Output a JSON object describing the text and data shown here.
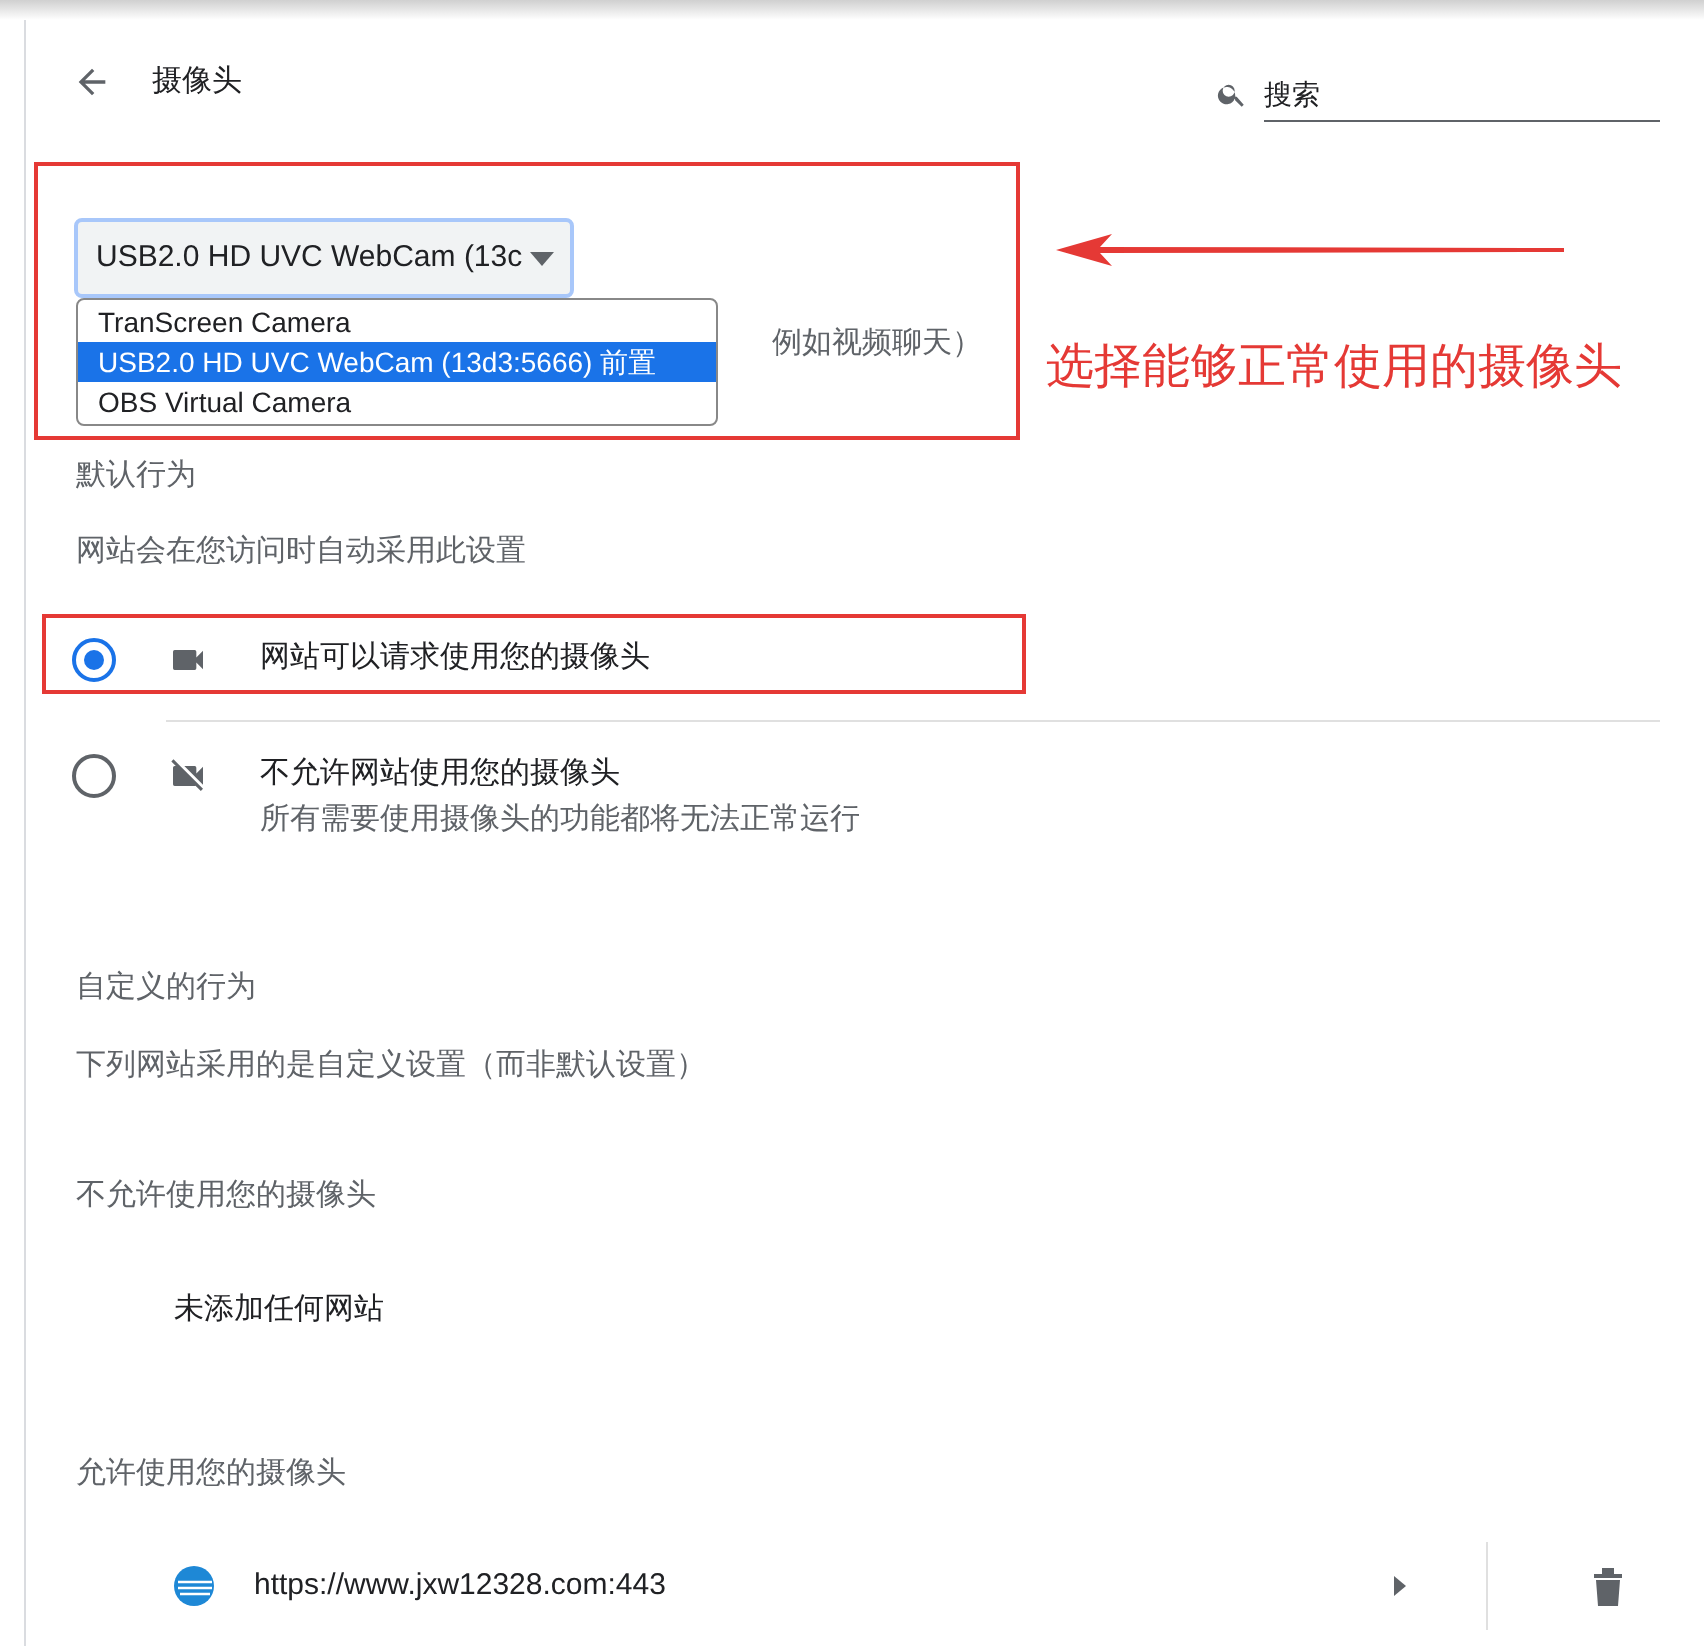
{
  "header": {
    "title": "摄像头",
    "search": {
      "placeholder": "搜索"
    }
  },
  "camera_select": {
    "value": "USB2.0 HD UVC WebCam (13c",
    "partial_description": "例如视频聊天）"
  },
  "dropdown_options": [
    {
      "label": "TranScreen Camera",
      "selected": false
    },
    {
      "label": "USB2.0 HD UVC WebCam (13d3:5666) 前置",
      "selected": true
    },
    {
      "label": "OBS Virtual Camera",
      "selected": false
    }
  ],
  "annotation": "选择能够正常使用的摄像头",
  "default_behavior": {
    "heading": "默认行为",
    "description": "网站会在您访问时自动采用此设置",
    "options": [
      {
        "label": "网站可以请求使用您的摄像头",
        "selected": true,
        "kind": "allow"
      },
      {
        "label": "不允许网站使用您的摄像头",
        "sublabel": "所有需要使用摄像头的功能都将无法正常运行",
        "selected": false,
        "kind": "block"
      }
    ]
  },
  "custom_behavior": {
    "heading": "自定义的行为",
    "description": "下列网站采用的是自定义设置（而非默认设置）"
  },
  "blocked": {
    "heading": "不允许使用您的摄像头",
    "empty": "未添加任何网站"
  },
  "allowed": {
    "heading": "允许使用您的摄像头",
    "sites": [
      {
        "url": "https://www.jxw12328.com:443"
      }
    ]
  }
}
